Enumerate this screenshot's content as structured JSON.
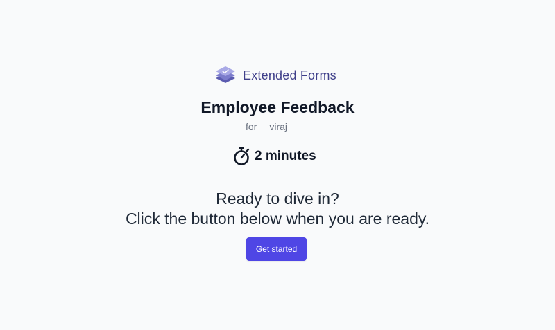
{
  "brand": {
    "name": "Extended Forms",
    "logo_icon": "stacked-layers-logo-icon",
    "color": "#3f3f8a"
  },
  "form": {
    "title": "Employee Feedback",
    "for_label": "for",
    "recipient": "viraj"
  },
  "duration": {
    "icon": "stopwatch-icon",
    "text": "2 minutes"
  },
  "message": {
    "line1": "Ready to dive in?",
    "line2": "Click the button below when you are ready."
  },
  "actions": {
    "start_label": "Get started",
    "accent": "#4f46e5"
  }
}
